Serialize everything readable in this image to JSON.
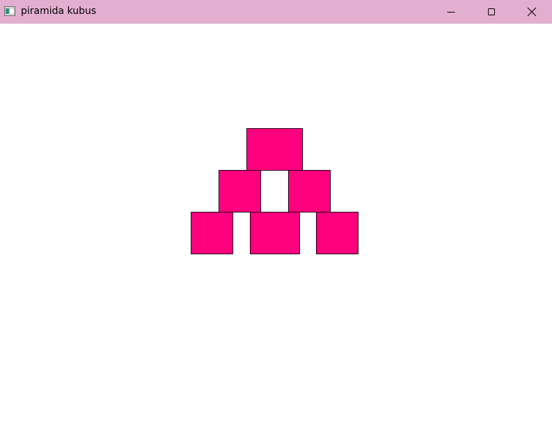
{
  "window": {
    "title": "piramida kubus",
    "titlebar_color": "#e3afd1"
  },
  "controls": {
    "minimize_icon": "minimize-icon",
    "maximize_icon": "maximize-icon",
    "close_icon": "close-icon"
  },
  "scene": {
    "cube_fill": "#ff007f",
    "cube_stroke": "#1a0010",
    "rows": [
      {
        "cubes": 1
      },
      {
        "cubes": 2
      },
      {
        "cubes": 3
      }
    ]
  }
}
